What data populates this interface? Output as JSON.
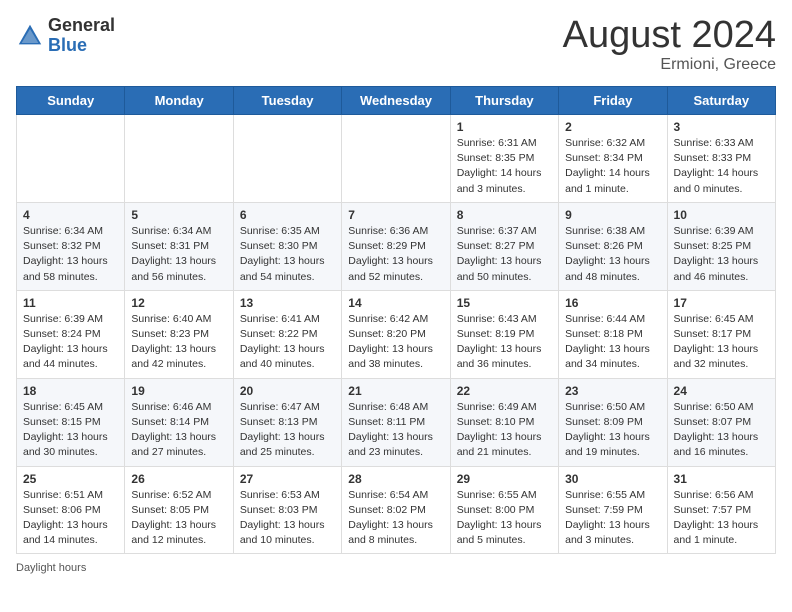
{
  "header": {
    "logo_general": "General",
    "logo_blue": "Blue",
    "month_year": "August 2024",
    "location": "Ermioni, Greece"
  },
  "days_of_week": [
    "Sunday",
    "Monday",
    "Tuesday",
    "Wednesday",
    "Thursday",
    "Friday",
    "Saturday"
  ],
  "weeks": [
    [
      {
        "day": "",
        "lines": []
      },
      {
        "day": "",
        "lines": []
      },
      {
        "day": "",
        "lines": []
      },
      {
        "day": "",
        "lines": []
      },
      {
        "day": "1",
        "lines": [
          "Sunrise: 6:31 AM",
          "Sunset: 8:35 PM",
          "Daylight: 14 hours",
          "and 3 minutes."
        ]
      },
      {
        "day": "2",
        "lines": [
          "Sunrise: 6:32 AM",
          "Sunset: 8:34 PM",
          "Daylight: 14 hours",
          "and 1 minute."
        ]
      },
      {
        "day": "3",
        "lines": [
          "Sunrise: 6:33 AM",
          "Sunset: 8:33 PM",
          "Daylight: 14 hours",
          "and 0 minutes."
        ]
      }
    ],
    [
      {
        "day": "4",
        "lines": [
          "Sunrise: 6:34 AM",
          "Sunset: 8:32 PM",
          "Daylight: 13 hours",
          "and 58 minutes."
        ]
      },
      {
        "day": "5",
        "lines": [
          "Sunrise: 6:34 AM",
          "Sunset: 8:31 PM",
          "Daylight: 13 hours",
          "and 56 minutes."
        ]
      },
      {
        "day": "6",
        "lines": [
          "Sunrise: 6:35 AM",
          "Sunset: 8:30 PM",
          "Daylight: 13 hours",
          "and 54 minutes."
        ]
      },
      {
        "day": "7",
        "lines": [
          "Sunrise: 6:36 AM",
          "Sunset: 8:29 PM",
          "Daylight: 13 hours",
          "and 52 minutes."
        ]
      },
      {
        "day": "8",
        "lines": [
          "Sunrise: 6:37 AM",
          "Sunset: 8:27 PM",
          "Daylight: 13 hours",
          "and 50 minutes."
        ]
      },
      {
        "day": "9",
        "lines": [
          "Sunrise: 6:38 AM",
          "Sunset: 8:26 PM",
          "Daylight: 13 hours",
          "and 48 minutes."
        ]
      },
      {
        "day": "10",
        "lines": [
          "Sunrise: 6:39 AM",
          "Sunset: 8:25 PM",
          "Daylight: 13 hours",
          "and 46 minutes."
        ]
      }
    ],
    [
      {
        "day": "11",
        "lines": [
          "Sunrise: 6:39 AM",
          "Sunset: 8:24 PM",
          "Daylight: 13 hours",
          "and 44 minutes."
        ]
      },
      {
        "day": "12",
        "lines": [
          "Sunrise: 6:40 AM",
          "Sunset: 8:23 PM",
          "Daylight: 13 hours",
          "and 42 minutes."
        ]
      },
      {
        "day": "13",
        "lines": [
          "Sunrise: 6:41 AM",
          "Sunset: 8:22 PM",
          "Daylight: 13 hours",
          "and 40 minutes."
        ]
      },
      {
        "day": "14",
        "lines": [
          "Sunrise: 6:42 AM",
          "Sunset: 8:20 PM",
          "Daylight: 13 hours",
          "and 38 minutes."
        ]
      },
      {
        "day": "15",
        "lines": [
          "Sunrise: 6:43 AM",
          "Sunset: 8:19 PM",
          "Daylight: 13 hours",
          "and 36 minutes."
        ]
      },
      {
        "day": "16",
        "lines": [
          "Sunrise: 6:44 AM",
          "Sunset: 8:18 PM",
          "Daylight: 13 hours",
          "and 34 minutes."
        ]
      },
      {
        "day": "17",
        "lines": [
          "Sunrise: 6:45 AM",
          "Sunset: 8:17 PM",
          "Daylight: 13 hours",
          "and 32 minutes."
        ]
      }
    ],
    [
      {
        "day": "18",
        "lines": [
          "Sunrise: 6:45 AM",
          "Sunset: 8:15 PM",
          "Daylight: 13 hours",
          "and 30 minutes."
        ]
      },
      {
        "day": "19",
        "lines": [
          "Sunrise: 6:46 AM",
          "Sunset: 8:14 PM",
          "Daylight: 13 hours",
          "and 27 minutes."
        ]
      },
      {
        "day": "20",
        "lines": [
          "Sunrise: 6:47 AM",
          "Sunset: 8:13 PM",
          "Daylight: 13 hours",
          "and 25 minutes."
        ]
      },
      {
        "day": "21",
        "lines": [
          "Sunrise: 6:48 AM",
          "Sunset: 8:11 PM",
          "Daylight: 13 hours",
          "and 23 minutes."
        ]
      },
      {
        "day": "22",
        "lines": [
          "Sunrise: 6:49 AM",
          "Sunset: 8:10 PM",
          "Daylight: 13 hours",
          "and 21 minutes."
        ]
      },
      {
        "day": "23",
        "lines": [
          "Sunrise: 6:50 AM",
          "Sunset: 8:09 PM",
          "Daylight: 13 hours",
          "and 19 minutes."
        ]
      },
      {
        "day": "24",
        "lines": [
          "Sunrise: 6:50 AM",
          "Sunset: 8:07 PM",
          "Daylight: 13 hours",
          "and 16 minutes."
        ]
      }
    ],
    [
      {
        "day": "25",
        "lines": [
          "Sunrise: 6:51 AM",
          "Sunset: 8:06 PM",
          "Daylight: 13 hours",
          "and 14 minutes."
        ]
      },
      {
        "day": "26",
        "lines": [
          "Sunrise: 6:52 AM",
          "Sunset: 8:05 PM",
          "Daylight: 13 hours",
          "and 12 minutes."
        ]
      },
      {
        "day": "27",
        "lines": [
          "Sunrise: 6:53 AM",
          "Sunset: 8:03 PM",
          "Daylight: 13 hours",
          "and 10 minutes."
        ]
      },
      {
        "day": "28",
        "lines": [
          "Sunrise: 6:54 AM",
          "Sunset: 8:02 PM",
          "Daylight: 13 hours",
          "and 8 minutes."
        ]
      },
      {
        "day": "29",
        "lines": [
          "Sunrise: 6:55 AM",
          "Sunset: 8:00 PM",
          "Daylight: 13 hours",
          "and 5 minutes."
        ]
      },
      {
        "day": "30",
        "lines": [
          "Sunrise: 6:55 AM",
          "Sunset: 7:59 PM",
          "Daylight: 13 hours",
          "and 3 minutes."
        ]
      },
      {
        "day": "31",
        "lines": [
          "Sunrise: 6:56 AM",
          "Sunset: 7:57 PM",
          "Daylight: 13 hours",
          "and 1 minute."
        ]
      }
    ]
  ],
  "footer": {
    "text": "Daylight hours"
  }
}
